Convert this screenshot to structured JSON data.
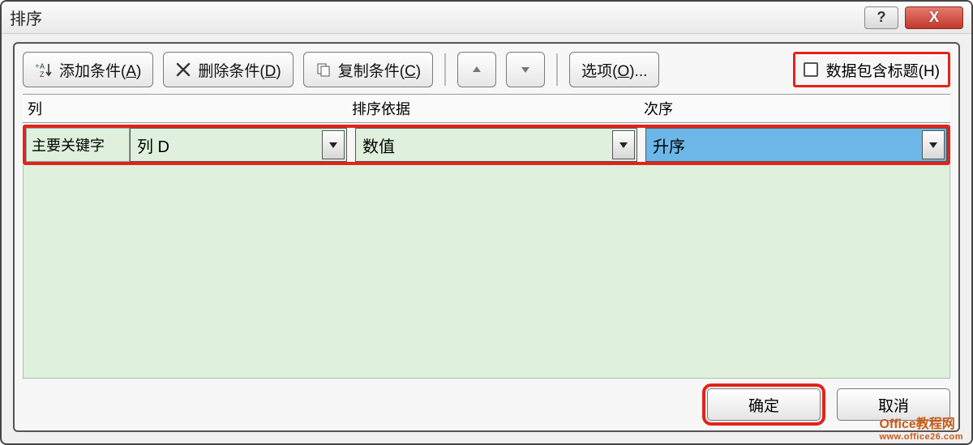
{
  "window": {
    "title": "排序",
    "help": "?",
    "close": "X"
  },
  "toolbar": {
    "add_label": "添加条件(",
    "add_key": "A",
    "add_tail": ")",
    "delete_label": "删除条件(",
    "delete_key": "D",
    "delete_tail": ")",
    "copy_label": "复制条件(",
    "copy_key": "C",
    "copy_tail": ")",
    "options_label": "选项(",
    "options_key": "O",
    "options_tail": ")...",
    "header_checkbox_label": "数据包含标题(",
    "header_checkbox_key": "H",
    "header_checkbox_tail": ")"
  },
  "headers": {
    "col": "列",
    "basis": "排序依据",
    "order": "次序"
  },
  "row": {
    "label": "主要关键字",
    "column_value": "列 D",
    "basis_value": "数值",
    "order_value": "升序"
  },
  "buttons": {
    "ok": "确定",
    "cancel": "取消"
  },
  "watermark": {
    "line1": "Office教程网",
    "line2": "www.office26.com"
  }
}
